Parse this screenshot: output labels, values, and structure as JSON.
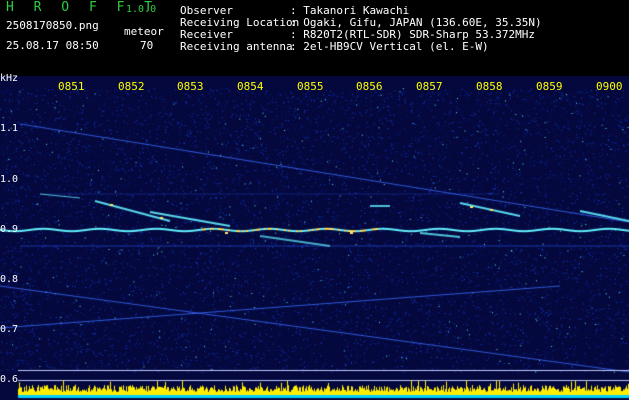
{
  "header": {
    "app_name": "H R O F F T",
    "version": "1.0.0",
    "filename": "2508170850.png",
    "datetime": "25.08.17 08:50",
    "mode_label": "meteor",
    "mode_value": "70",
    "fields": [
      {
        "label": "Observer",
        "value": ": Takanori Kawachi"
      },
      {
        "label": "Receiving Location",
        "value": ": Ogaki, Gifu, JAPAN (136.60E, 35.35N)"
      },
      {
        "label": "Receiver",
        "value": ": R820T2(RTL-SDR) SDR-Sharp 53.372MHz"
      },
      {
        "label": "Receiving antenna",
        "value": ": 2el-HB9CV Vertical (el. E-W)"
      }
    ]
  },
  "spectrogram": {
    "y_unit": "kHz",
    "y_ticks": [
      "1.1",
      "1.0",
      "0.9",
      "0.8",
      "0.7",
      "0.6"
    ],
    "time_ticks": [
      "0851",
      "0852",
      "0853",
      "0854",
      "0855",
      "0856",
      "0857",
      "0858",
      "0859",
      "0900"
    ],
    "colors": {
      "background": "#04083c",
      "noise": "#1b3fd6",
      "signal": "#62f0ff",
      "hot": "#ffe46a",
      "level": "#ffee00",
      "level_base": "#00d0ff"
    }
  }
}
